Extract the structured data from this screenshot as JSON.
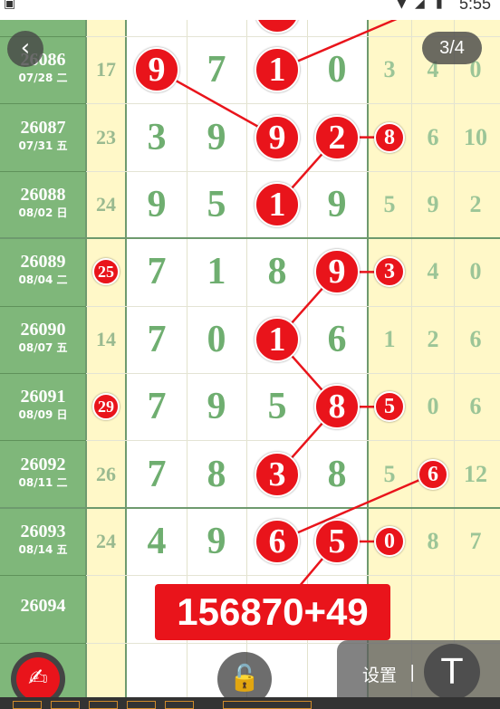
{
  "status_bar": {
    "time": "5:55"
  },
  "nav": {
    "back_icon": "chevron-left-icon",
    "page_indicator": "3/4"
  },
  "colors": {
    "ball": "#e9141b",
    "issue_column": "#7fb77a",
    "digit": "#6fae70"
  },
  "rows": [
    {
      "issue": "26086",
      "date": "07/28 二",
      "sum": "17",
      "sum_ball": false,
      "digits": [
        "9",
        "7",
        "1",
        "0"
      ],
      "digit_balls": [
        true,
        false,
        true,
        false
      ],
      "right": [
        "3",
        "4",
        "0"
      ],
      "right_balls": [
        false,
        false,
        false
      ]
    },
    {
      "issue": "26087",
      "date": "07/31 五",
      "sum": "23",
      "sum_ball": false,
      "digits": [
        "3",
        "9",
        "9",
        "2"
      ],
      "digit_balls": [
        false,
        false,
        true,
        true
      ],
      "right": [
        "8",
        "6",
        "10"
      ],
      "right_balls": [
        true,
        false,
        false
      ]
    },
    {
      "issue": "26088",
      "date": "08/02 日",
      "sum": "24",
      "sum_ball": false,
      "digits": [
        "9",
        "5",
        "1",
        "9"
      ],
      "digit_balls": [
        false,
        false,
        true,
        false
      ],
      "right": [
        "5",
        "9",
        "2"
      ],
      "right_balls": [
        false,
        false,
        false
      ]
    },
    {
      "issue": "26089",
      "date": "08/04 二",
      "sum": "25",
      "sum_ball": true,
      "digits": [
        "7",
        "1",
        "8",
        "9"
      ],
      "digit_balls": [
        false,
        false,
        false,
        true
      ],
      "right": [
        "3",
        "4",
        "0"
      ],
      "right_balls": [
        true,
        false,
        false
      ]
    },
    {
      "issue": "26090",
      "date": "08/07 五",
      "sum": "14",
      "sum_ball": false,
      "digits": [
        "7",
        "0",
        "1",
        "6"
      ],
      "digit_balls": [
        false,
        false,
        true,
        false
      ],
      "right": [
        "1",
        "2",
        "6"
      ],
      "right_balls": [
        false,
        false,
        false
      ]
    },
    {
      "issue": "26091",
      "date": "08/09 日",
      "sum": "29",
      "sum_ball": true,
      "digits": [
        "7",
        "9",
        "5",
        "8"
      ],
      "digit_balls": [
        false,
        false,
        false,
        true
      ],
      "right": [
        "5",
        "0",
        "6"
      ],
      "right_balls": [
        true,
        false,
        false
      ]
    },
    {
      "issue": "26092",
      "date": "08/11 二",
      "sum": "26",
      "sum_ball": false,
      "digits": [
        "7",
        "8",
        "3",
        "8"
      ],
      "digit_balls": [
        false,
        false,
        true,
        false
      ],
      "right": [
        "5",
        "6",
        "12"
      ],
      "right_balls": [
        false,
        true,
        false
      ]
    },
    {
      "issue": "26093",
      "date": "08/14 五",
      "sum": "24",
      "sum_ball": false,
      "digits": [
        "4",
        "9",
        "6",
        "5"
      ],
      "digit_balls": [
        false,
        false,
        true,
        true
      ],
      "right": [
        "0",
        "8",
        "7"
      ],
      "right_balls": [
        true,
        false,
        false
      ]
    },
    {
      "issue": "26094",
      "date": "",
      "sum": "",
      "sum_ball": false,
      "digits": [
        "",
        "",
        "",
        ""
      ],
      "digit_balls": [
        false,
        false,
        false,
        false
      ],
      "right": [
        "",
        "",
        ""
      ],
      "right_balls": [
        false,
        false,
        false
      ]
    }
  ],
  "prediction": "156870+49",
  "toolbar": {
    "pen_icon": "pen-icon",
    "lock_icon": "lock-icon",
    "settings_label": "设置",
    "separator": "|",
    "text_tool_icon": "text-tool-icon",
    "text_tool_glyph": "T"
  }
}
